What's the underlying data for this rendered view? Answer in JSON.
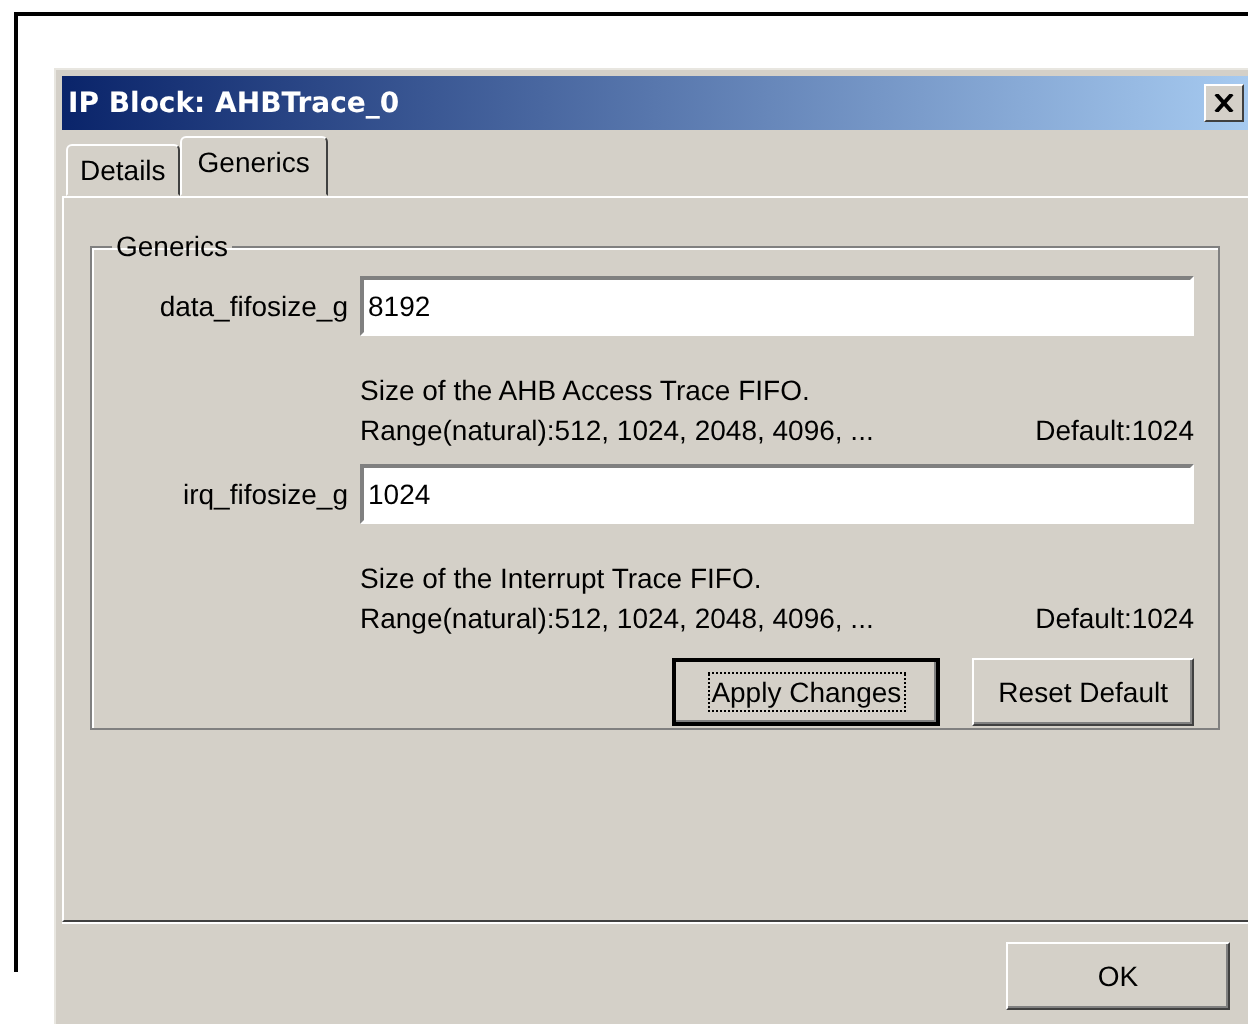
{
  "window": {
    "title": "IP Block: AHBTrace_0"
  },
  "tabs": [
    {
      "label": "Details",
      "selected": false
    },
    {
      "label": "Generics",
      "selected": true
    }
  ],
  "group": {
    "title": "Generics",
    "params": [
      {
        "name": "data_fifosize_g",
        "value": "8192",
        "description": "Size of the AHB Access Trace FIFO.",
        "range": "Range(natural):512, 1024, 2048, 4096, ...",
        "default": "Default:1024"
      },
      {
        "name": "irq_fifosize_g",
        "value": "1024",
        "description": "Size of the Interrupt Trace FIFO.",
        "range": "Range(natural):512, 1024, 2048, 4096, ...",
        "default": "Default:1024"
      }
    ],
    "buttons": [
      {
        "label": "Apply Changes",
        "focused": true
      },
      {
        "label": "Reset Default",
        "focused": false
      }
    ]
  },
  "footer_buttons": [
    {
      "label": "OK",
      "focused": false
    }
  ]
}
